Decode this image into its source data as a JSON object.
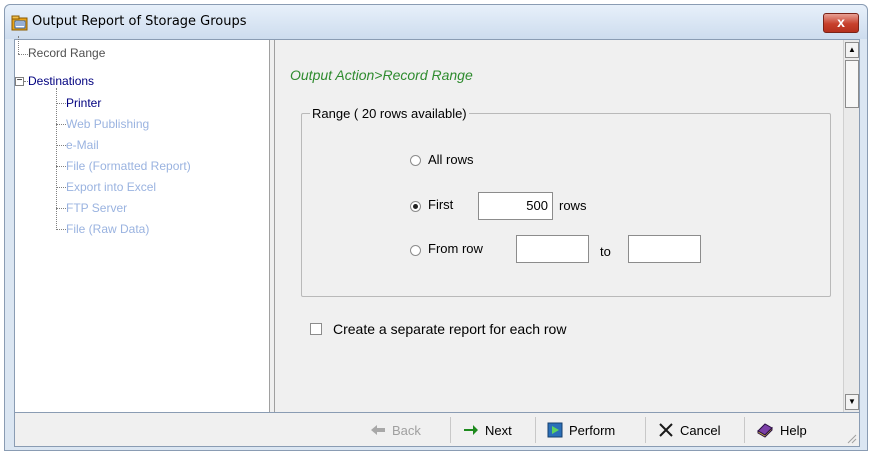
{
  "window": {
    "title": "Output Report of Storage Groups",
    "close_glyph": "x",
    "icon": "folder-app-icon"
  },
  "tree": {
    "record_range": "Record Range",
    "destinations": "Destinations",
    "expander": "−",
    "items": [
      {
        "label": "Printer",
        "state": "active"
      },
      {
        "label": "Web Publishing",
        "state": "disabled"
      },
      {
        "label": "e-Mail",
        "state": "disabled"
      },
      {
        "label": "File (Formatted Report)",
        "state": "disabled"
      },
      {
        "label": "Export into Excel",
        "state": "disabled"
      },
      {
        "label": "FTP Server",
        "state": "disabled"
      },
      {
        "label": "File (Raw Data)",
        "state": "disabled"
      }
    ]
  },
  "main": {
    "section_title": "Output Action>Record Range",
    "range_group": {
      "legend": "Range ( 20 rows available)",
      "all_rows": "All rows",
      "first": "First",
      "first_value": "500",
      "rows_suffix": "rows",
      "from_row": "From row",
      "from_value": "",
      "to": "to",
      "to_value": "",
      "selected": "first"
    },
    "separate_report": {
      "label": "Create a separate report for each row",
      "checked": false
    }
  },
  "toolbar": {
    "back": "Back",
    "next": "Next",
    "perform": "Perform",
    "cancel": "Cancel",
    "help": "Help",
    "back_enabled": false
  },
  "colors": {
    "section_title": "#2e8b2e",
    "tree_active": "#00007f",
    "tree_disabled": "#9ab3e0",
    "close_button": "#c7402c"
  }
}
